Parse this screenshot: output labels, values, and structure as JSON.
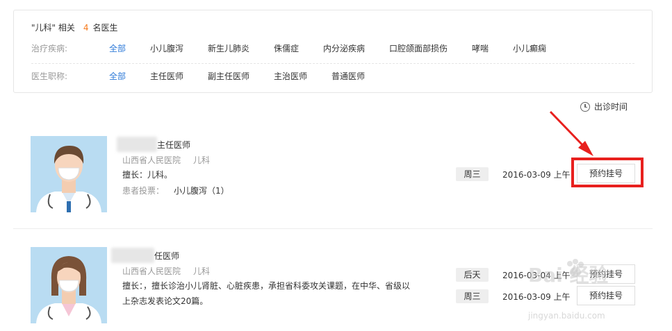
{
  "summary": {
    "quote": "\"儿科\"",
    "pre": "相关",
    "count": "4",
    "post": "名医生"
  },
  "filters": {
    "disease": {
      "label": "治疗疾病:",
      "options": [
        "全部",
        "小儿腹泻",
        "新生儿肺炎",
        "侏儒症",
        "内分泌疾病",
        "口腔颌面部损伤",
        "哮喘",
        "小儿癫痫"
      ]
    },
    "title": {
      "label": "医生职称:",
      "options": [
        "全部",
        "主任医师",
        "副主任医师",
        "主治医师",
        "普通医师"
      ]
    }
  },
  "sort": {
    "label": "出诊时间"
  },
  "doctors": [
    {
      "name_suffix": "主任医师",
      "hospital": "山西省人民医院",
      "dept": "儿科",
      "good_at": "擅长：儿科。",
      "vote_label": "患者投票：",
      "vote_value": "小儿腹泻（1）",
      "slots": [
        {
          "day": "周三",
          "date": "2016-03-09 上午",
          "button": "预约挂号"
        }
      ]
    },
    {
      "name_suffix": "任医师",
      "hospital": "山西省人民医院",
      "dept": "儿科",
      "good_at": "擅长：，擅长诊治小儿肾脏、心脏疾患，承担省科委攻关课题，在中华、省级以上杂志发表论文20篇。",
      "slots": [
        {
          "day": "后天",
          "date": "2016-03-04 上午",
          "button": "预约挂号"
        },
        {
          "day": "周三",
          "date": "2016-03-09 上午",
          "button": "预约挂号"
        }
      ]
    }
  ],
  "watermark": {
    "text": "Bai 经验",
    "url": "jingyan.baidu.com"
  },
  "colors": {
    "accent": "#2e7ad8",
    "count": "#f77b1c",
    "highlight": "#e8201e",
    "avatar_bg": "#b9dcf2"
  }
}
